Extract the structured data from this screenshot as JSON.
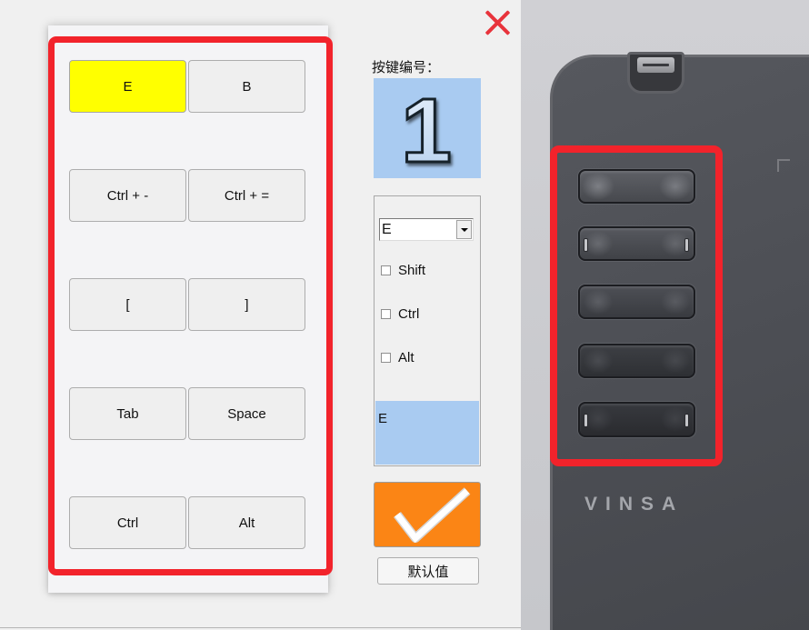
{
  "icons": {
    "close": "close-icon",
    "dropdown": "dropdown-arrow-icon",
    "confirm": "checkmark-icon"
  },
  "colors": {
    "highlight_frame": "#f2232b",
    "selected_key": "#ffff00",
    "number_box": "#a9cbf1",
    "confirm_button": "#fb8515",
    "close_icon": "#e8333b"
  },
  "keypad": {
    "buttons": [
      {
        "label": "E",
        "selected": true
      },
      {
        "label": "B",
        "selected": false
      },
      {
        "label": "Ctrl + -",
        "selected": false
      },
      {
        "label": "Ctrl + =",
        "selected": false
      },
      {
        "label": "[",
        "selected": false
      },
      {
        "label": "]",
        "selected": false
      },
      {
        "label": "Tab",
        "selected": false
      },
      {
        "label": "Space",
        "selected": false
      },
      {
        "label": "Ctrl",
        "selected": false
      },
      {
        "label": "Alt",
        "selected": false
      }
    ]
  },
  "key_editor": {
    "number_label": "按键编号：",
    "number": "1",
    "key_select": {
      "value": "E"
    },
    "modifiers": [
      {
        "label": "Shift",
        "checked": false
      },
      {
        "label": "Ctrl",
        "checked": false
      },
      {
        "label": "Alt",
        "checked": false
      }
    ],
    "preview": "E",
    "default_button": "默认值"
  },
  "device_photo": {
    "brand": "VINSA"
  }
}
